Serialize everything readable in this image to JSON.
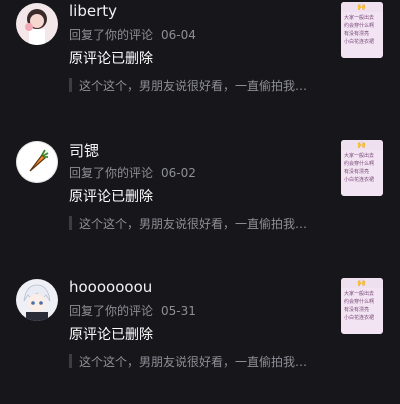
{
  "colors": {
    "background": "#16161b",
    "primary_text": "#ffffff",
    "secondary_text": "#8e8e96",
    "quote_bar": "#3c3c44",
    "thumbnail_bg": "#f2e4f2"
  },
  "notifications": [
    {
      "username": "liberty",
      "action": "回复了你的评论",
      "date": "06-04",
      "body": "原评论已删除",
      "quote": "这个这个，男朋友说很好看，一直偷拍我…",
      "avatar_icon": "girl-photo-avatar",
      "thumbnail_emoji": "🙌",
      "thumbnail_text": "大家一般出去\n约会穿什么啊\n有没有漂亮\n小白花连衣裙"
    },
    {
      "username": "司锶",
      "action": "回复了你的评论",
      "date": "06-02",
      "body": "原评论已删除",
      "quote": "这个这个，男朋友说很好看，一直偷拍我…",
      "avatar_icon": "carrot-avatar",
      "thumbnail_emoji": "🙌",
      "thumbnail_text": "大家一般出去\n约会穿什么啊\n有没有漂亮\n小白花连衣裙"
    },
    {
      "username": "hooooooou",
      "action": "回复了你的评论",
      "date": "05-31",
      "body": "原评论已删除",
      "quote": "这个这个，男朋友说很好看，一直偷拍我…",
      "avatar_icon": "anime-boy-avatar",
      "thumbnail_emoji": "🙌",
      "thumbnail_text": "大家一般出去\n约会穿什么啊\n有没有漂亮\n小白花连衣裙"
    }
  ]
}
